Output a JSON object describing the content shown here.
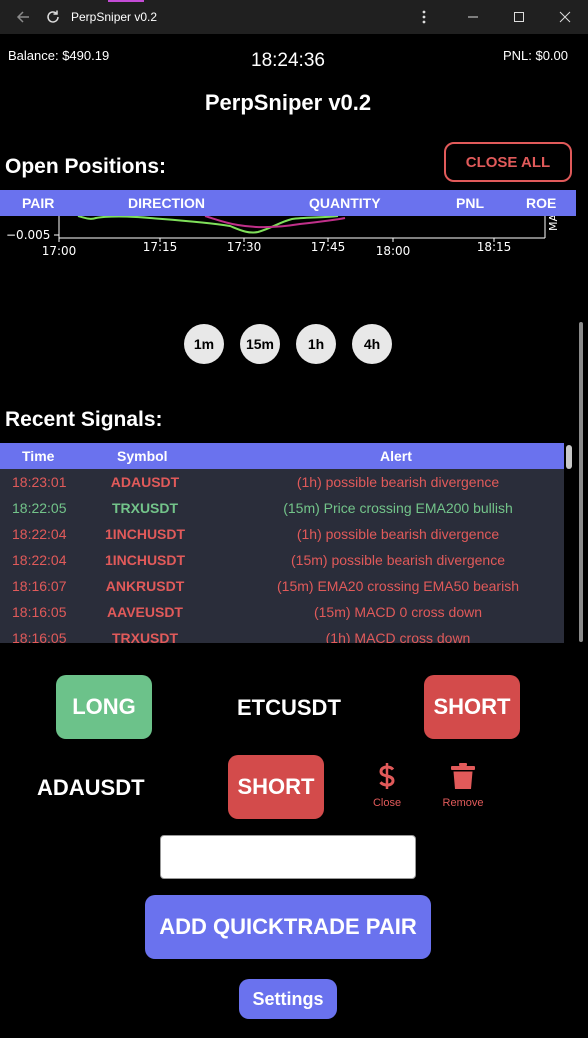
{
  "window": {
    "title": "PerpSniper v0.2",
    "icons": [
      "back-icon",
      "reload-icon",
      "more-icon",
      "minimize-icon",
      "maximize-icon",
      "close-icon"
    ]
  },
  "header": {
    "balance": "Balance: $490.19",
    "clock": "18:24:36",
    "pnl": "PNL: $0.00",
    "title": "PerpSniper v0.2"
  },
  "open_positions": {
    "title": "Open Positions:",
    "close_all_label": "CLOSE ALL",
    "columns": [
      "PAIR",
      "DIRECTION",
      "QUANTITY",
      "PNL",
      "ROE"
    ]
  },
  "chart": {
    "y_tick": "−0.005",
    "x_ticks": [
      "17:00",
      "17:15",
      "17:30",
      "17:45",
      "18:00",
      "18:15"
    ],
    "right_label": "MA",
    "colors": {
      "green": "#7fe05a",
      "magenta": "#c0308a"
    }
  },
  "timeframes": [
    "1m",
    "15m",
    "1h",
    "4h"
  ],
  "signals": {
    "title": "Recent Signals:",
    "columns": [
      "Time",
      "Symbol",
      "Alert"
    ],
    "rows": [
      {
        "time": "18:23:01",
        "symbol": "ADAUSDT",
        "alert": "(1h) possible bearish divergence",
        "tone": "red"
      },
      {
        "time": "18:22:05",
        "symbol": "TRXUSDT",
        "alert": "(15m) Price crossing EMA200 bullish",
        "tone": "green"
      },
      {
        "time": "18:22:04",
        "symbol": "1INCHUSDT",
        "alert": "(1h) possible bearish divergence",
        "tone": "red"
      },
      {
        "time": "18:22:04",
        "symbol": "1INCHUSDT",
        "alert": "(15m) possible bearish divergence",
        "tone": "red"
      },
      {
        "time": "18:16:07",
        "symbol": "ANKRUSDT",
        "alert": "(15m) EMA20 crossing EMA50 bearish",
        "tone": "red"
      },
      {
        "time": "18:16:05",
        "symbol": "AAVEUSDT",
        "alert": "(15m) MACD 0 cross down",
        "tone": "red"
      },
      {
        "time": "18:16:05",
        "symbol": "TRXUSDT",
        "alert": "(1h) MACD cross down",
        "tone": "red"
      }
    ]
  },
  "quicktrade": {
    "long_label": "LONG",
    "short_label": "SHORT",
    "pairs": [
      {
        "symbol": "ETCUSDT"
      },
      {
        "symbol": "ADAUSDT"
      }
    ],
    "close_icon": "dollar-icon",
    "close_label": "Close",
    "remove_icon": "trash-icon",
    "remove_label": "Remove",
    "input_value": "",
    "add_label": "ADD QUICKTRADE PAIR",
    "settings_label": "Settings"
  },
  "colors": {
    "accent": "#6a72ee",
    "long": "#6cc28a",
    "short": "#d34b4b",
    "bearish_text": "#e15a5a",
    "bullish_text": "#73c48a",
    "table_bg": "#2a2d3a"
  }
}
